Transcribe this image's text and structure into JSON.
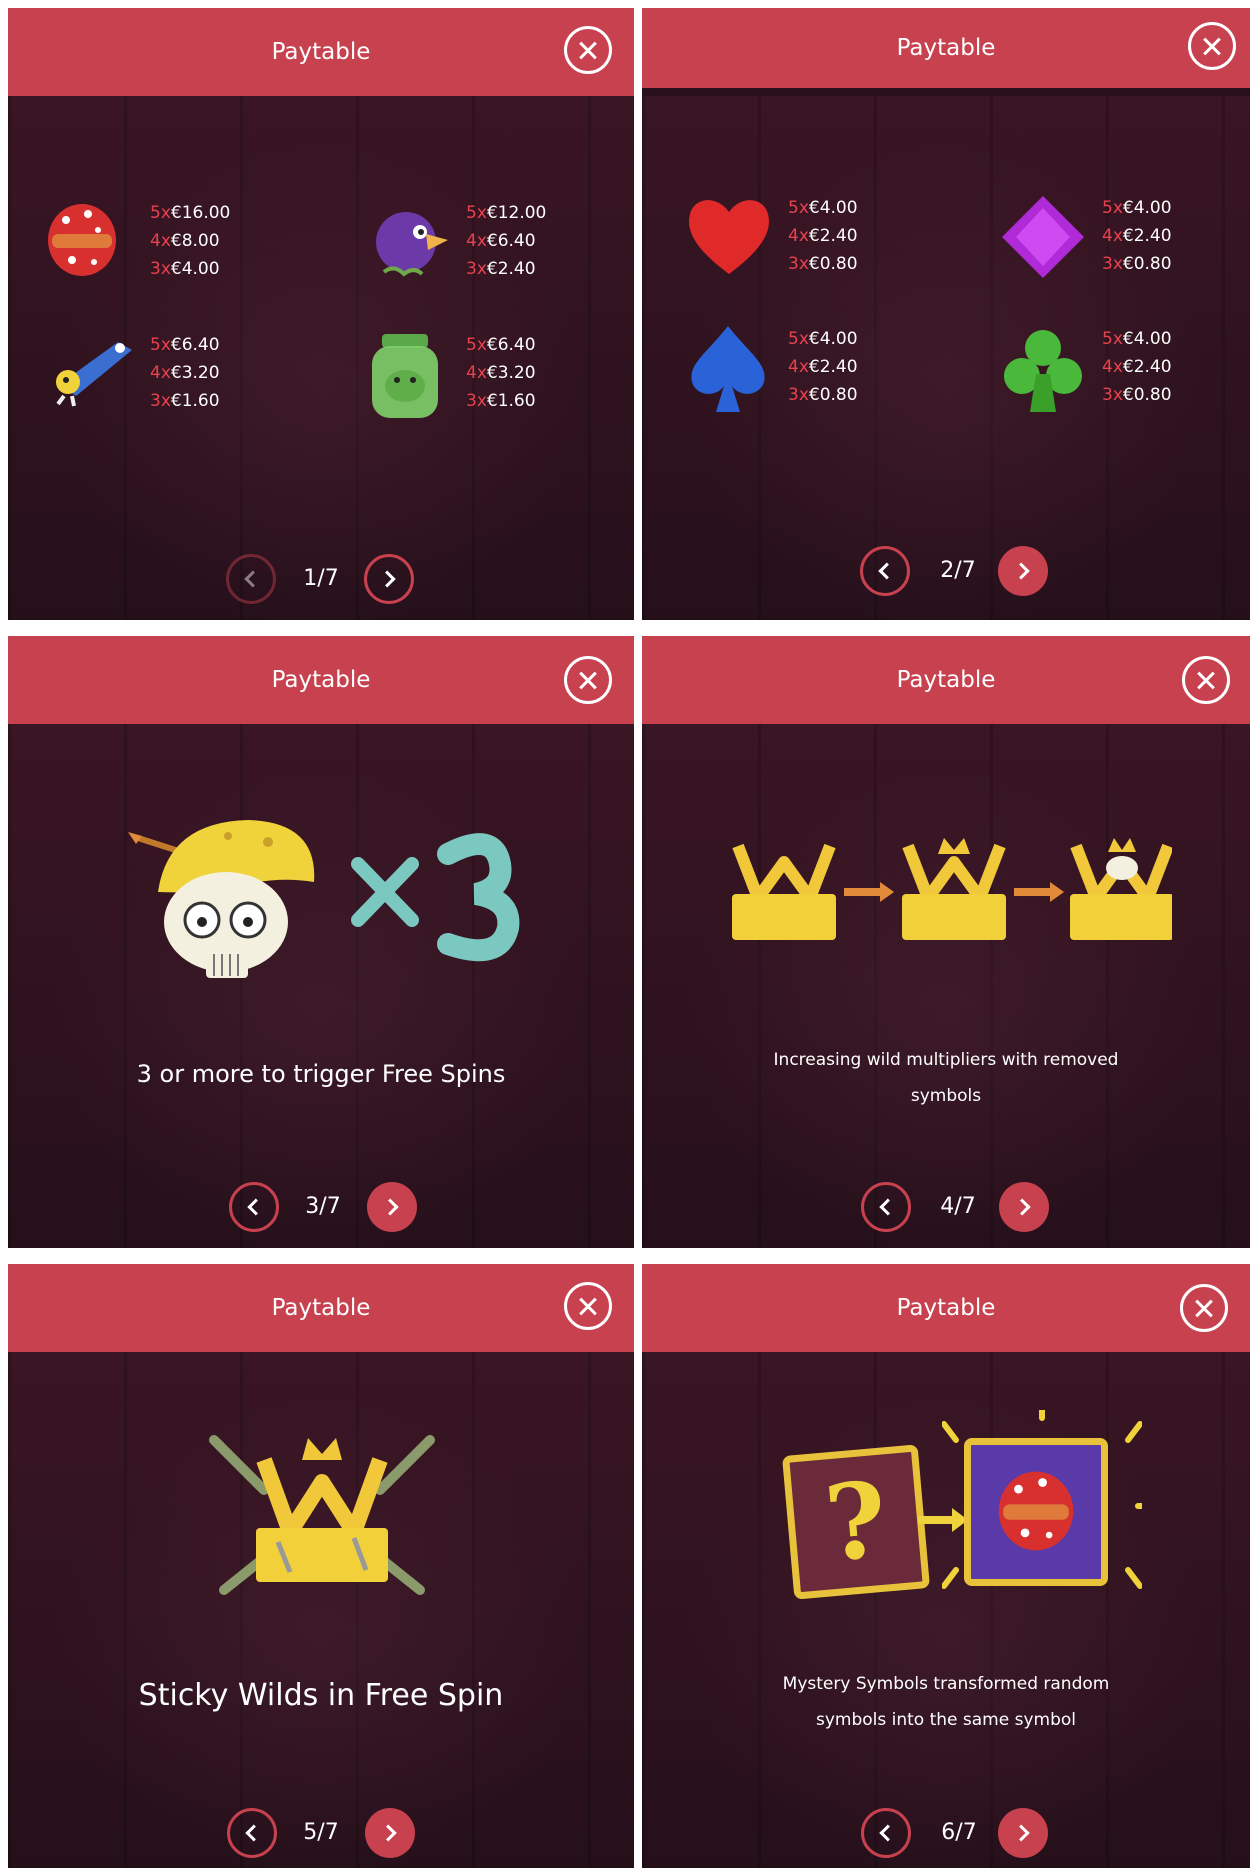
{
  "header_title": "Paytable",
  "colors": {
    "accent": "#c8414f",
    "multiplier": "#e8424f",
    "background": "#2a0f1c"
  },
  "panels": [
    {
      "page": "1/7",
      "pays": [
        {
          "symbol": "mushroom-burger-icon",
          "lines": [
            [
              "5x",
              "€16.00"
            ],
            [
              "4x",
              "€8.00"
            ],
            [
              "3x",
              "€4.00"
            ]
          ]
        },
        {
          "symbol": "purple-bird-icon",
          "lines": [
            [
              "5x",
              "€12.00"
            ],
            [
              "4x",
              "€6.40"
            ],
            [
              "3x",
              "€2.40"
            ]
          ]
        },
        {
          "symbol": "blue-fish-icon",
          "lines": [
            [
              "5x",
              "€6.40"
            ],
            [
              "4x",
              "€3.20"
            ],
            [
              "3x",
              "€1.60"
            ]
          ]
        },
        {
          "symbol": "green-jar-icon",
          "lines": [
            [
              "5x",
              "€6.40"
            ],
            [
              "4x",
              "€3.20"
            ],
            [
              "3x",
              "€1.60"
            ]
          ]
        }
      ]
    },
    {
      "page": "2/7",
      "pays": [
        {
          "symbol": "red-heart-icon",
          "lines": [
            [
              "5x",
              "€4.00"
            ],
            [
              "4x",
              "€2.40"
            ],
            [
              "3x",
              "€0.80"
            ]
          ]
        },
        {
          "symbol": "purple-diamond-icon",
          "lines": [
            [
              "5x",
              "€4.00"
            ],
            [
              "4x",
              "€2.40"
            ],
            [
              "3x",
              "€0.80"
            ]
          ]
        },
        {
          "symbol": "blue-spade-icon",
          "lines": [
            [
              "5x",
              "€4.00"
            ],
            [
              "4x",
              "€2.40"
            ],
            [
              "3x",
              "€0.80"
            ]
          ]
        },
        {
          "symbol": "green-club-icon",
          "lines": [
            [
              "5x",
              "€4.00"
            ],
            [
              "4x",
              "€2.40"
            ],
            [
              "3x",
              "€0.80"
            ]
          ]
        }
      ]
    },
    {
      "page": "3/7",
      "caption": "3 or more to trigger Free Spins",
      "multiplier_text": "×3"
    },
    {
      "page": "4/7",
      "caption_line1": "Increasing wild multipliers with removed",
      "caption_line2": "symbols"
    },
    {
      "page": "5/7",
      "caption": "Sticky Wilds in Free Spin"
    },
    {
      "page": "6/7",
      "caption_line1": "Mystery Symbols transformed random",
      "caption_line2": "symbols into the same symbol",
      "mystery_glyph": "?"
    }
  ]
}
